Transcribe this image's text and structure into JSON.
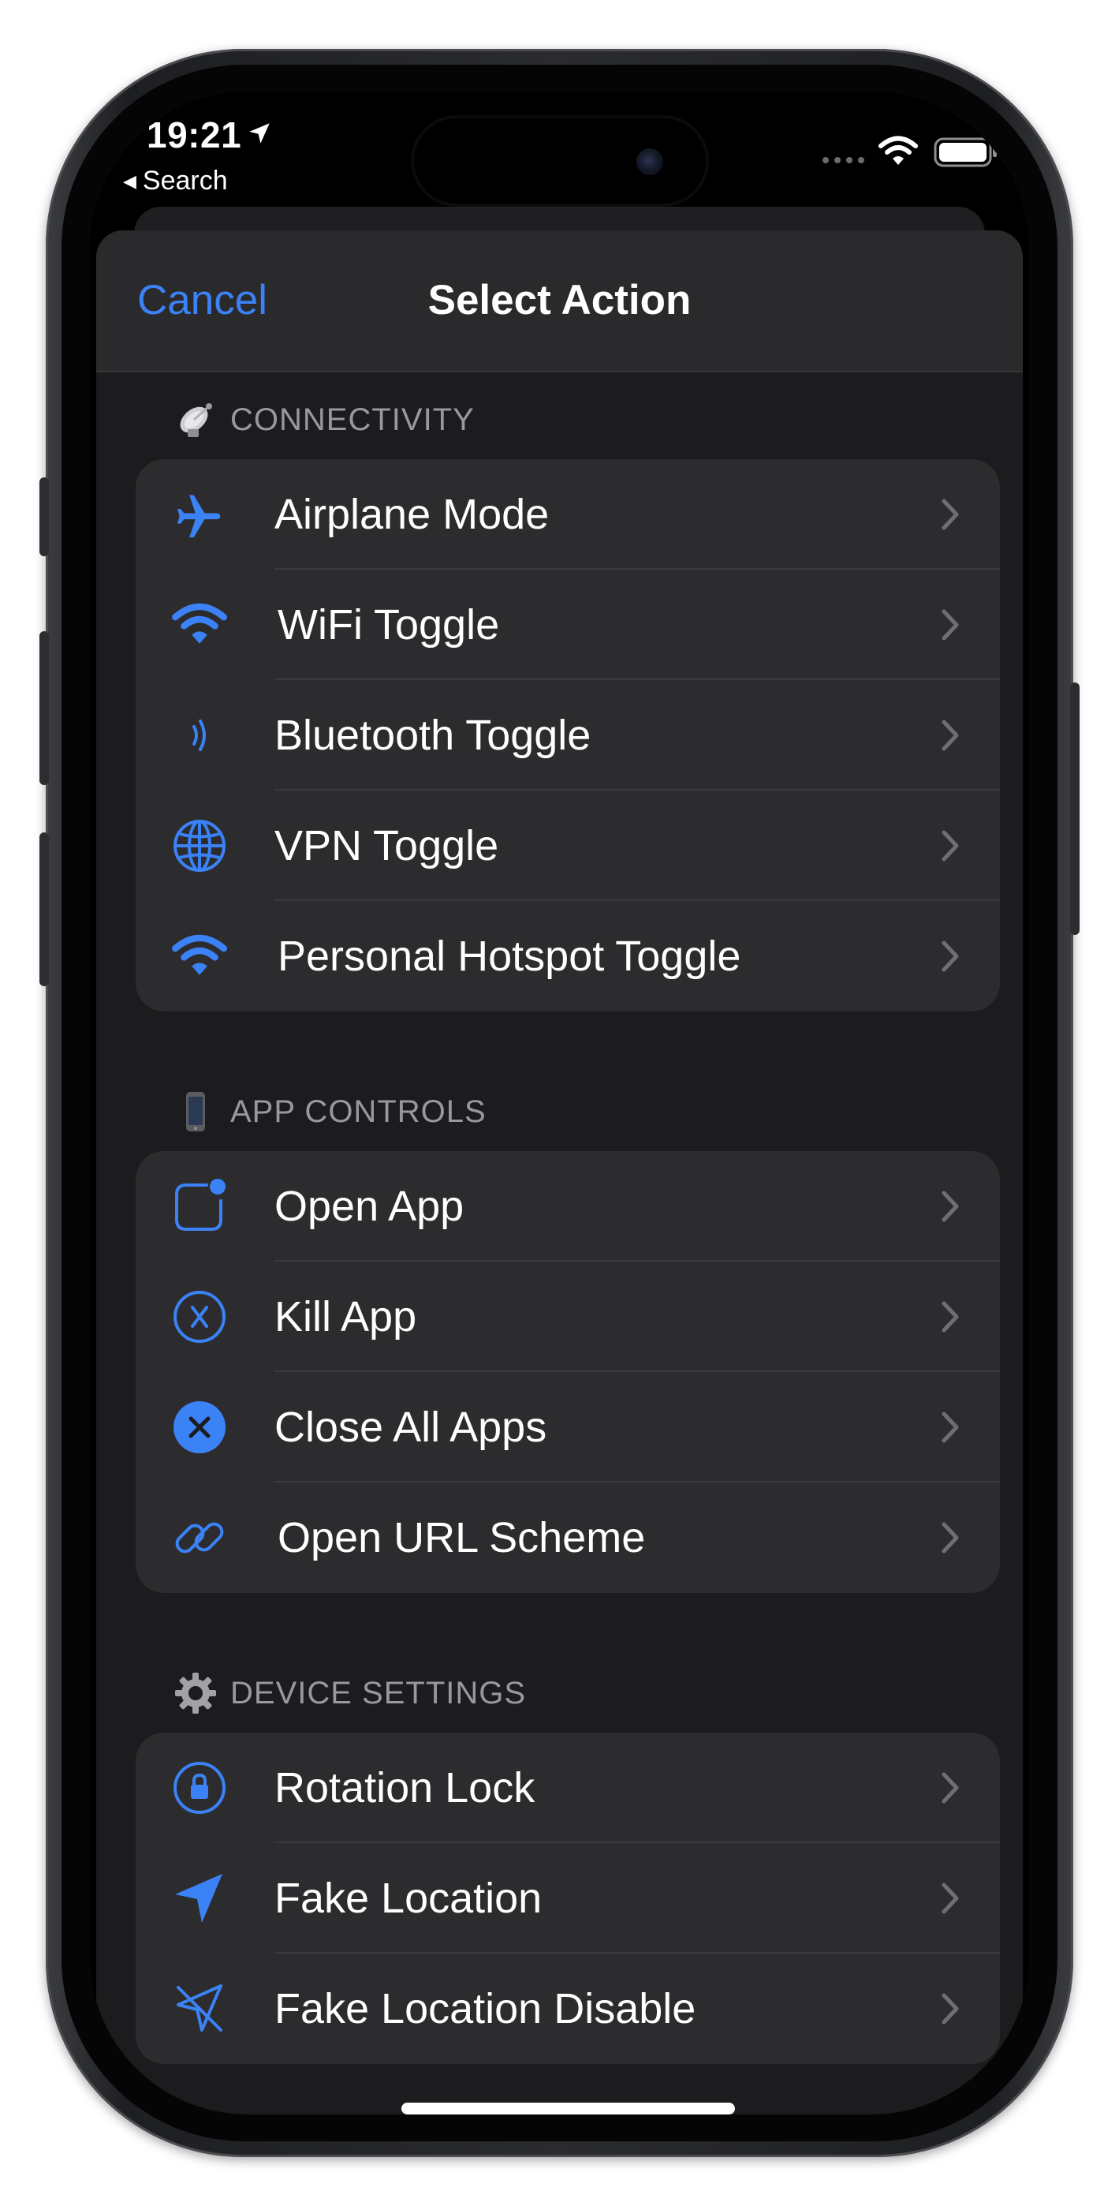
{
  "status_bar": {
    "time": "19:21",
    "back_label": "Search"
  },
  "nav": {
    "cancel_label": "Cancel",
    "title": "Select Action"
  },
  "colors": {
    "accent": "#3b82f6",
    "sheet_bg": "#1c1c1e",
    "group_bg": "#2c2c2e",
    "section_text": "#98989e"
  },
  "sections": [
    {
      "title": "CONNECTIVITY",
      "emoji_icon": "satellite-dish-icon",
      "items": [
        {
          "label": "Airplane Mode",
          "icon": "airplane-icon"
        },
        {
          "label": "WiFi Toggle",
          "icon": "wifi-icon"
        },
        {
          "label": "Bluetooth Toggle",
          "icon": "bluetooth-waves-icon"
        },
        {
          "label": "VPN Toggle",
          "icon": "globe-icon"
        },
        {
          "label": "Personal Hotspot Toggle",
          "icon": "hotspot-icon"
        }
      ]
    },
    {
      "title": "APP CONTROLS",
      "emoji_icon": "mobile-phone-icon",
      "items": [
        {
          "label": "Open App",
          "icon": "app-badge-icon"
        },
        {
          "label": "Kill App",
          "icon": "x-circle-icon"
        },
        {
          "label": "Close All Apps",
          "icon": "x-circle-fill-icon"
        },
        {
          "label": "Open URL Scheme",
          "icon": "link-icon"
        }
      ]
    },
    {
      "title": "DEVICE SETTINGS",
      "emoji_icon": "gear-icon",
      "items": [
        {
          "label": "Rotation Lock",
          "icon": "lock-rotation-icon"
        },
        {
          "label": "Fake Location",
          "icon": "location-arrow-icon"
        },
        {
          "label": "Fake Location Disable",
          "icon": "location-slash-icon"
        }
      ]
    }
  ]
}
